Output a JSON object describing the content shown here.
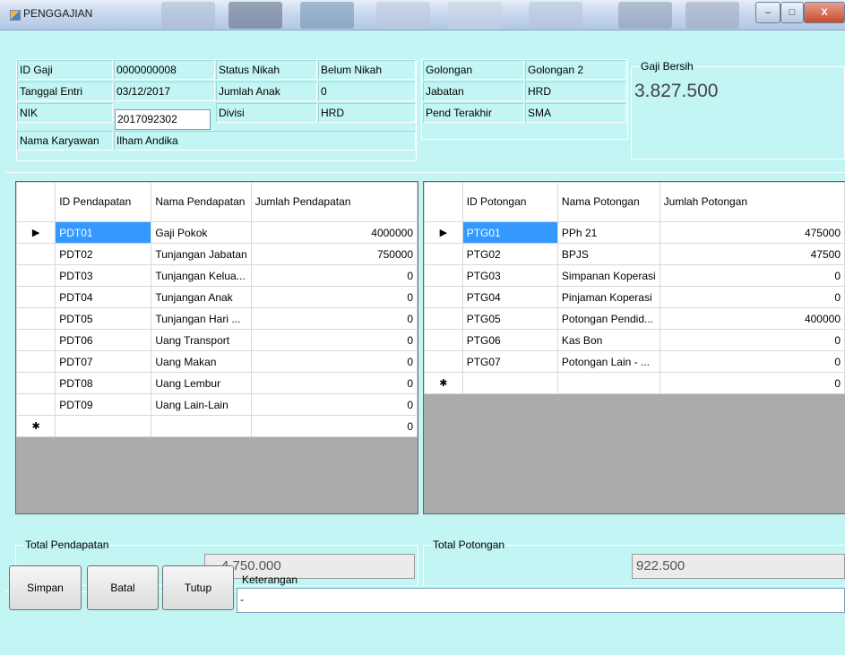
{
  "window": {
    "title": "PENGGAJIAN",
    "min_label": "–",
    "max_label": "□",
    "close_label": "X"
  },
  "info": {
    "id_gaji_label": "ID Gaji",
    "id_gaji_value": "0000000008",
    "tanggal_label": "Tanggal Entri",
    "tanggal_value": "03/12/2017",
    "nik_label": "NIK",
    "nik_value": "2017092302",
    "nama_label": "Nama Karyawan",
    "nama_value": "Ilham Andika",
    "status_label": "Status Nikah",
    "status_value": "Belum Nikah",
    "anak_label": "Jumlah Anak",
    "anak_value": "0",
    "divisi_label": "Divisi",
    "divisi_value": "HRD",
    "golongan_label": "Golongan",
    "golongan_value": "Golongan 2",
    "jabatan_label": "Jabatan",
    "jabatan_value": "HRD",
    "pend_label": "Pend Terakhir",
    "pend_value": "SMA"
  },
  "gaji_bersih": {
    "label": "Gaji Bersih",
    "value": "3.827.500"
  },
  "pendapatan": {
    "columns": [
      "ID Pendapatan",
      "Nama Pendapatan",
      "Jumlah Pendapatan"
    ],
    "rows": [
      {
        "id": "PDT01",
        "nama": "Gaji Pokok",
        "jumlah": "4000000"
      },
      {
        "id": "PDT02",
        "nama": "Tunjangan Jabatan",
        "jumlah": "750000"
      },
      {
        "id": "PDT03",
        "nama": "Tunjangan Kelua...",
        "jumlah": "0"
      },
      {
        "id": "PDT04",
        "nama": "Tunjangan Anak",
        "jumlah": "0"
      },
      {
        "id": "PDT05",
        "nama": "Tunjangan Hari ...",
        "jumlah": "0"
      },
      {
        "id": "PDT06",
        "nama": "Uang Transport",
        "jumlah": "0"
      },
      {
        "id": "PDT07",
        "nama": "Uang Makan",
        "jumlah": "0"
      },
      {
        "id": "PDT08",
        "nama": "Uang Lembur",
        "jumlah": "0"
      },
      {
        "id": "PDT09",
        "nama": "Uang Lain-Lain",
        "jumlah": "0"
      }
    ],
    "new_row_jumlah": "0"
  },
  "potongan": {
    "columns": [
      "ID Potongan",
      "Nama Potongan",
      "Jumlah Potongan"
    ],
    "rows": [
      {
        "id": "PTG01",
        "nama": "PPh 21",
        "jumlah": "475000"
      },
      {
        "id": "PTG02",
        "nama": "BPJS",
        "jumlah": "47500"
      },
      {
        "id": "PTG03",
        "nama": "Simpanan Koperasi",
        "jumlah": "0"
      },
      {
        "id": "PTG04",
        "nama": "Pinjaman Koperasi",
        "jumlah": "0"
      },
      {
        "id": "PTG05",
        "nama": "Potongan Pendid...",
        "jumlah": "400000"
      },
      {
        "id": "PTG06",
        "nama": "Kas Bon",
        "jumlah": "0"
      },
      {
        "id": "PTG07",
        "nama": "Potongan Lain - ...",
        "jumlah": "0"
      }
    ],
    "new_row_jumlah": "0"
  },
  "totals": {
    "pendapatan_label": "Total Pendapatan",
    "pendapatan_value": "4.750.000",
    "potongan_label": "Total Potongan",
    "potongan_value": "922.500"
  },
  "buttons": {
    "simpan": "Simpan",
    "batal": "Batal",
    "tutup": "Tutup"
  },
  "keterangan": {
    "label": "Keterangan",
    "value": "-"
  },
  "grid_markers": {
    "current": "▶",
    "new": "✱"
  },
  "colors": {
    "form_background": "#c3f5f5",
    "selection": "#3399ff"
  }
}
